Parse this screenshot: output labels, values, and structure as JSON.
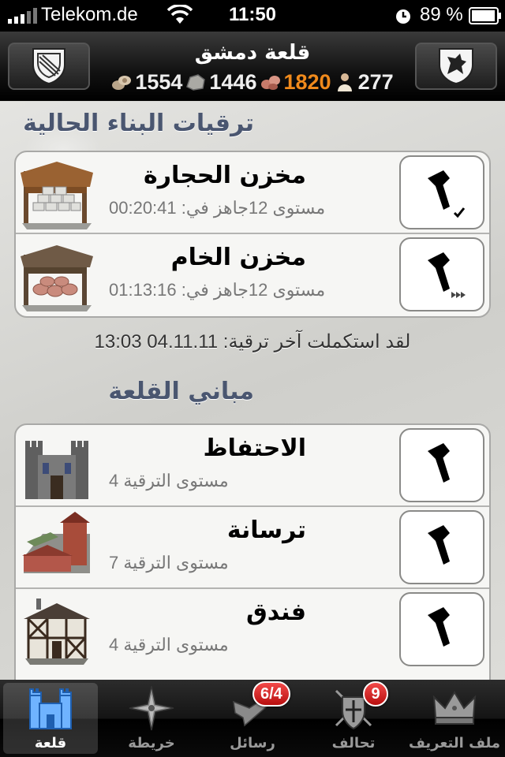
{
  "status_bar": {
    "carrier": "Telekom.de",
    "time": "11:50",
    "battery": "89 %"
  },
  "nav": {
    "title": "قلعة دمشق",
    "resources": [
      {
        "icon": "wood-icon",
        "value": "1554"
      },
      {
        "icon": "stone-icon",
        "value": "1446"
      },
      {
        "icon": "ore-icon",
        "value": "1820"
      },
      {
        "icon": "population-icon",
        "value": "277"
      }
    ],
    "highlight_color": "#f08a1c"
  },
  "current_upgrades": {
    "title": "ترقيات البناء الحالية",
    "items": [
      {
        "name": "مخزن الحجارة",
        "detail": "مستوى 12جاهز في: 00:20:41",
        "icon": "stone-warehouse-icon",
        "status_icon": "checkmark-icon"
      },
      {
        "name": "مخزن الخام",
        "detail": "مستوى 12جاهز في: 01:13:16",
        "icon": "ore-warehouse-icon",
        "status_icon": "fast-forward-icon"
      }
    ],
    "last_completed": "لقد استكملت آخر ترقية: 04.11.11 13:03"
  },
  "castle_buildings": {
    "title": "مباني القلعة",
    "items": [
      {
        "name": "الاحتفاظ",
        "detail": "مستوى الترقية  4",
        "icon": "keep-icon"
      },
      {
        "name": "ترسانة",
        "detail": "مستوى الترقية  7",
        "icon": "arsenal-icon"
      },
      {
        "name": "فندق",
        "detail": "مستوى الترقية  4",
        "icon": "tavern-icon"
      }
    ]
  },
  "tabs": [
    {
      "label": "قلعة",
      "icon": "castle-icon",
      "active": true
    },
    {
      "label": "خريطة",
      "icon": "compass-icon"
    },
    {
      "label": "رسائل",
      "icon": "raven-icon",
      "badge": "6/4"
    },
    {
      "label": "تحالف",
      "icon": "alliance-shield-icon",
      "badge": "9"
    },
    {
      "label": "ملف التعريف",
      "icon": "crown-icon"
    }
  ]
}
